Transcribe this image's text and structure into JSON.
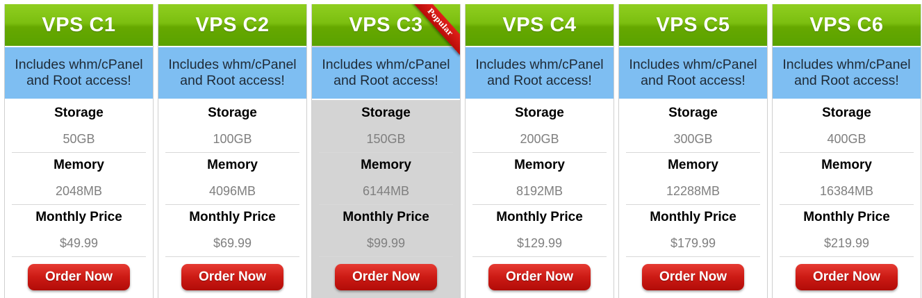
{
  "plans": [
    {
      "name": "VPS C1",
      "banner_line1": "Includes whm/cPanel",
      "banner_line2": "and Root access!",
      "storage_label": "Storage",
      "storage": "50GB",
      "memory_label": "Memory",
      "memory": "2048MB",
      "price_label": "Monthly Price",
      "price": "$49.99",
      "order_label": "Order Now"
    },
    {
      "name": "VPS C2",
      "banner_line1": "Includes whm/cPanel",
      "banner_line2": "and Root access!",
      "storage_label": "Storage",
      "storage": "100GB",
      "memory_label": "Memory",
      "memory": "4096MB",
      "price_label": "Monthly Price",
      "price": "$69.99",
      "order_label": "Order Now"
    },
    {
      "name": "VPS C3",
      "banner_line1": "Includes whm/cPanel",
      "banner_line2": "and Root access!",
      "storage_label": "Storage",
      "storage": "150GB",
      "memory_label": "Memory",
      "memory": "6144MB",
      "price_label": "Monthly Price",
      "price": "$99.99",
      "order_label": "Order Now",
      "ribbon": "Popular"
    },
    {
      "name": "VPS C4",
      "banner_line1": "Includes whm/cPanel",
      "banner_line2": "and Root access!",
      "storage_label": "Storage",
      "storage": "200GB",
      "memory_label": "Memory",
      "memory": "8192MB",
      "price_label": "Monthly Price",
      "price": "$129.99",
      "order_label": "Order Now"
    },
    {
      "name": "VPS C5",
      "banner_line1": "Includes whm/cPanel",
      "banner_line2": "and Root access!",
      "storage_label": "Storage",
      "storage": "300GB",
      "memory_label": "Memory",
      "memory": "12288MB",
      "price_label": "Monthly Price",
      "price": "$179.99",
      "order_label": "Order Now"
    },
    {
      "name": "VPS C6",
      "banner_line1": "Includes whm/cPanel",
      "banner_line2": "and Root access!",
      "storage_label": "Storage",
      "storage": "400GB",
      "memory_label": "Memory",
      "memory": "16384MB",
      "price_label": "Monthly Price",
      "price": "$219.99",
      "order_label": "Order Now"
    }
  ],
  "colors": {
    "header_green": "#6cb30a",
    "banner_blue": "#7ebef2",
    "popular_column": "#d4d4d4",
    "order_red": "#cc1a14",
    "value_gray": "#7f7f7f"
  }
}
